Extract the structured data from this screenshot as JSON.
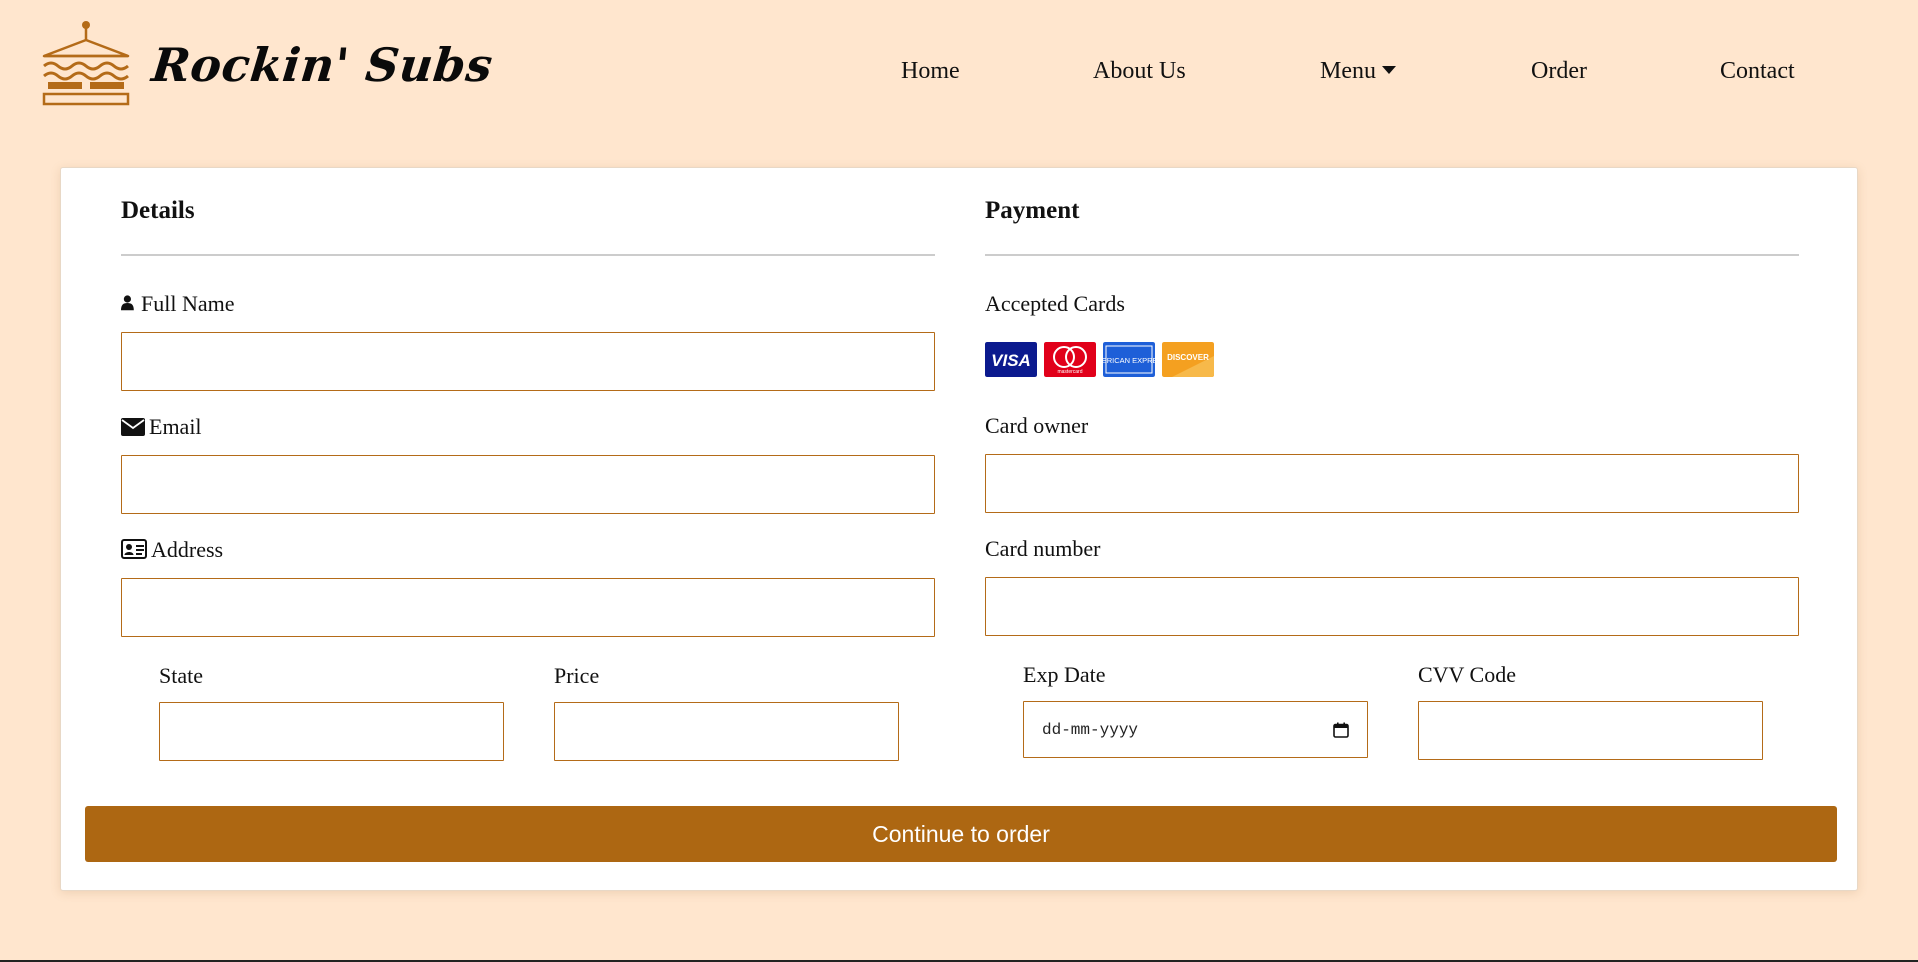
{
  "brand": {
    "name": "Rockin' Subs",
    "logo_icon": "sandwich-icon",
    "accent_color": "#b46b18"
  },
  "nav": {
    "items": [
      {
        "label": "Home"
      },
      {
        "label": "About Us"
      },
      {
        "label": "Menu",
        "has_dropdown": true
      },
      {
        "label": "Order"
      },
      {
        "label": "Contact"
      }
    ]
  },
  "details": {
    "title": "Details",
    "full_name": {
      "label": "Full Name",
      "icon": "user-icon",
      "value": "",
      "placeholder": ""
    },
    "email": {
      "label": "Email",
      "icon": "envelope-icon",
      "value": "",
      "placeholder": ""
    },
    "address": {
      "label": "Address",
      "icon": "address-card-icon",
      "value": "",
      "placeholder": ""
    },
    "state": {
      "label": "State",
      "value": "",
      "placeholder": ""
    },
    "price": {
      "label": "Price",
      "value": "",
      "placeholder": ""
    }
  },
  "payment": {
    "title": "Payment",
    "accepted_cards": {
      "label": "Accepted Cards",
      "cards": [
        {
          "name": "visa-card-icon",
          "text": "VISA",
          "color": "#0b1a8e"
        },
        {
          "name": "mastercard-card-icon",
          "text": "mastercard",
          "color": "#e1001a"
        },
        {
          "name": "amex-card-icon",
          "text": "AMERICAN EXPRESS",
          "color": "#1e5fd8"
        },
        {
          "name": "discover-card-icon",
          "text": "DISCOVER",
          "color": "#f4a020"
        }
      ]
    },
    "card_owner": {
      "label": "Card owner",
      "value": "",
      "placeholder": ""
    },
    "card_number": {
      "label": "Card number",
      "value": "",
      "placeholder": ""
    },
    "exp_date": {
      "label": "Exp Date",
      "placeholder": "dd-mm-yyyy"
    },
    "cvv": {
      "label": "CVV Code",
      "value": "",
      "placeholder": ""
    }
  },
  "submit": {
    "label": "Continue to order",
    "color": "#ad6712"
  },
  "colors": {
    "background": "#ffe6ce",
    "input_border": "#b46b18"
  }
}
